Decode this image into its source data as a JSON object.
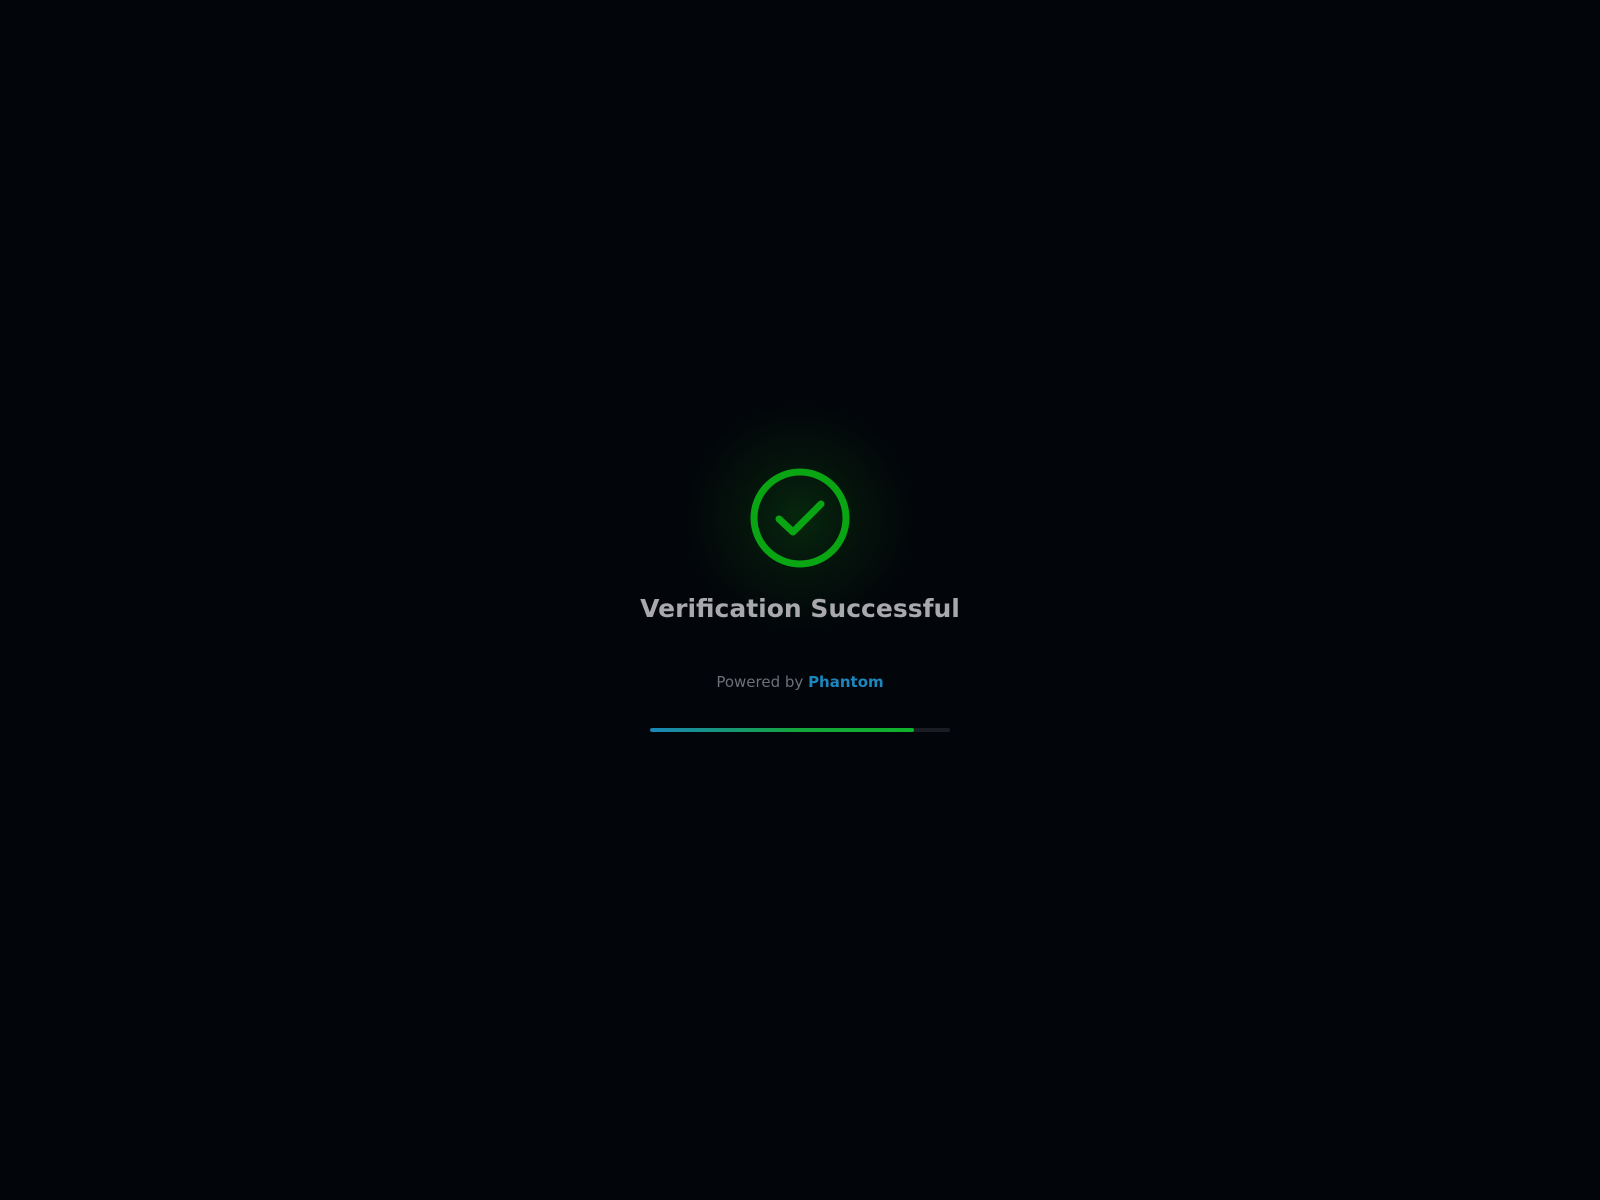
{
  "status": {
    "icon": "check-circle-icon",
    "title": "Verification Successful"
  },
  "footer": {
    "powered_by_label": "Powered by",
    "brand": "Phantom"
  },
  "progress": {
    "fraction": 0.88
  },
  "colors": {
    "background": "#02050a",
    "success": "#0aa512",
    "title_text": "#a8a8ad",
    "powered_text": "#6d7076",
    "brand": "#1c86be",
    "progress_start": "#1a86b8",
    "progress_end": "#10b22a",
    "progress_track": "#1a1e24"
  }
}
